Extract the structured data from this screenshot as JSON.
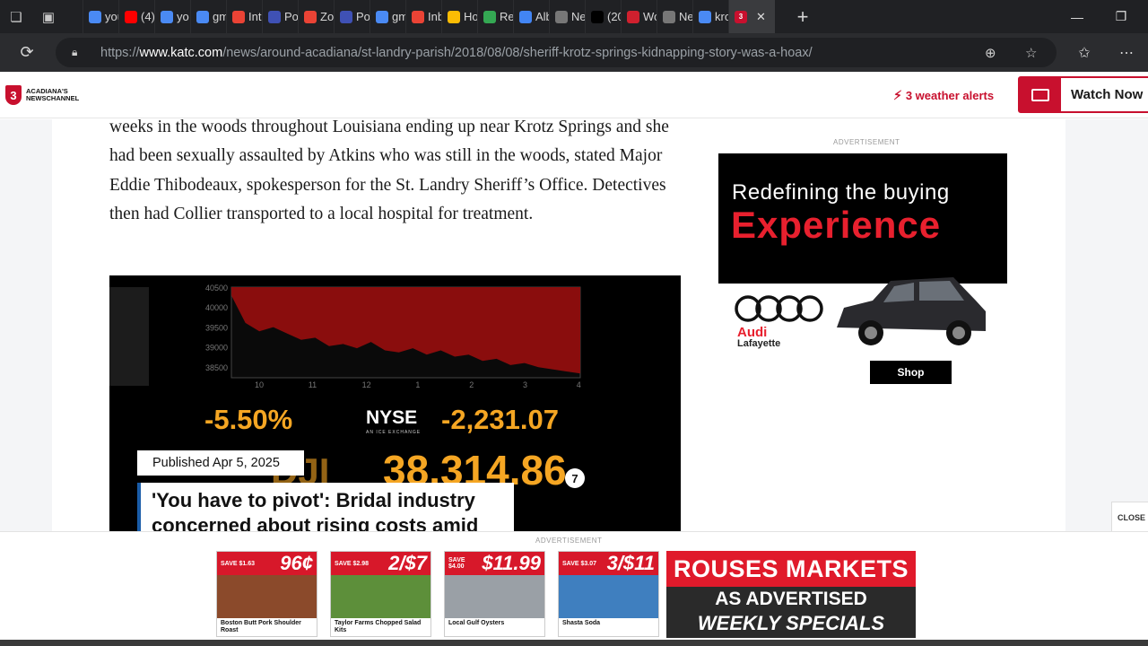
{
  "browser": {
    "tabs": [
      {
        "label": "you",
        "icon": "search-icon",
        "color": "#4a8af4"
      },
      {
        "label": "(4)",
        "icon": "youtube-icon",
        "color": "#ff0000"
      },
      {
        "label": "yo",
        "icon": "search-icon",
        "color": "#4a8af4"
      },
      {
        "label": "gm",
        "icon": "search-icon",
        "color": "#4a8af4"
      },
      {
        "label": "Int",
        "icon": "gmail-icon",
        "color": "#ea4335"
      },
      {
        "label": "Po",
        "icon": "zm-icon",
        "color": "#3f51b5"
      },
      {
        "label": "Zo",
        "icon": "gmail-icon",
        "color": "#ea4335"
      },
      {
        "label": "Po",
        "icon": "zm-icon",
        "color": "#3f51b5"
      },
      {
        "label": "gm",
        "icon": "search-icon",
        "color": "#4a8af4"
      },
      {
        "label": "Inb",
        "icon": "gmail-icon",
        "color": "#ea4335"
      },
      {
        "label": "Ho",
        "icon": "drive-icon",
        "color": "#fbbc04"
      },
      {
        "label": "Re",
        "icon": "drive-icon",
        "color": "#34a853"
      },
      {
        "label": "Alb",
        "icon": "photos-icon",
        "color": "#4285f4"
      },
      {
        "label": "Ne",
        "icon": "page-icon",
        "color": "#777777"
      },
      {
        "label": "(20",
        "icon": "x-icon",
        "color": "#000000"
      },
      {
        "label": "Wo",
        "icon": "k-icon",
        "color": "#d0202e"
      },
      {
        "label": "Ne",
        "icon": "page-icon",
        "color": "#777777"
      },
      {
        "label": "kro",
        "icon": "search-icon",
        "color": "#4a8af4"
      }
    ],
    "active_tab_icon": "katc-icon",
    "url_scheme": "https://",
    "url_host": "www.katc.com",
    "url_path": "/news/around-acadiana/st-landry-parish/2018/08/08/sheriff-krotz-springs-kidnapping-story-was-a-hoax/"
  },
  "header": {
    "logo_line1": "ACADIANA'S",
    "logo_line2": "NEWSCHANNEL",
    "logo_badge": "3",
    "alerts": "3 weather alerts",
    "watch": "Watch Now"
  },
  "article": {
    "paragraph": "weeks in the woods throughout Louisiana ending up near Krotz Springs and she had been sexually assaulted by Atkins who was still in the woods, stated Major Eddie Thibodeaux, spokesperson for the St. Landry Sheriff’s Office. Detectives then had Collier transported to a local hospital for treatment."
  },
  "video": {
    "pct": "-5.50%",
    "exchange": "NYSE",
    "exchange_sub": "AN ICE EXCHANGE",
    "change": "-2,231.07",
    "index": "DJI",
    "value": "38,314.86",
    "channel": "7",
    "published": "Published Apr 5, 2025",
    "headline": "'You have to pivot': Bridal industry concerned about rising costs amid tariff uncertainty"
  },
  "chart_data": {
    "type": "area",
    "y_ticks": [
      "40500",
      "40000",
      "39500",
      "39000",
      "38500"
    ],
    "x_ticks": [
      "10",
      "11",
      "12",
      "1",
      "2",
      "3",
      "4"
    ],
    "ylim": [
      38400,
      40550
    ],
    "values": [
      40350,
      39700,
      39500,
      39600,
      39450,
      39300,
      39350,
      39150,
      39200,
      39100,
      39250,
      39050,
      39000,
      39100,
      38950,
      39050,
      38900,
      38950,
      38800,
      38850,
      38700,
      38750,
      38650,
      38600,
      38550,
      38500
    ],
    "fill_color": "#8a0d0d"
  },
  "ad_right": {
    "label": "ADVERTISEMENT",
    "line1": "Redefining the buying",
    "line2": "Experience",
    "brand": "Audi",
    "city": "Lafayette",
    "cta": "Shop"
  },
  "ad_bottom": {
    "label": "ADVERTISEMENT",
    "close": "CLOSE",
    "promos": [
      {
        "save": "SAVE $1.63",
        "price": "96¢",
        "caption": "Boston Butt Pork Shoulder Roast",
        "color": "#8b4a2b"
      },
      {
        "save": "SAVE $2.98",
        "price": "2/$7",
        "caption": "Taylor Farms Chopped Salad Kits",
        "color": "#5d8f3a"
      },
      {
        "save": "SAVE $4.00",
        "price": "$11.99",
        "caption": "Local Gulf Oysters",
        "color": "#9aa0a6"
      },
      {
        "save": "SAVE $3.07",
        "price": "3/$11",
        "caption": "Shasta Soda",
        "color": "#3f7fbf"
      }
    ],
    "rouses_title": "ROUSES MARKETS",
    "rouses_sub1": "AS ADVERTISED",
    "rouses_sub2": "WEEKLY SPECIALS"
  }
}
